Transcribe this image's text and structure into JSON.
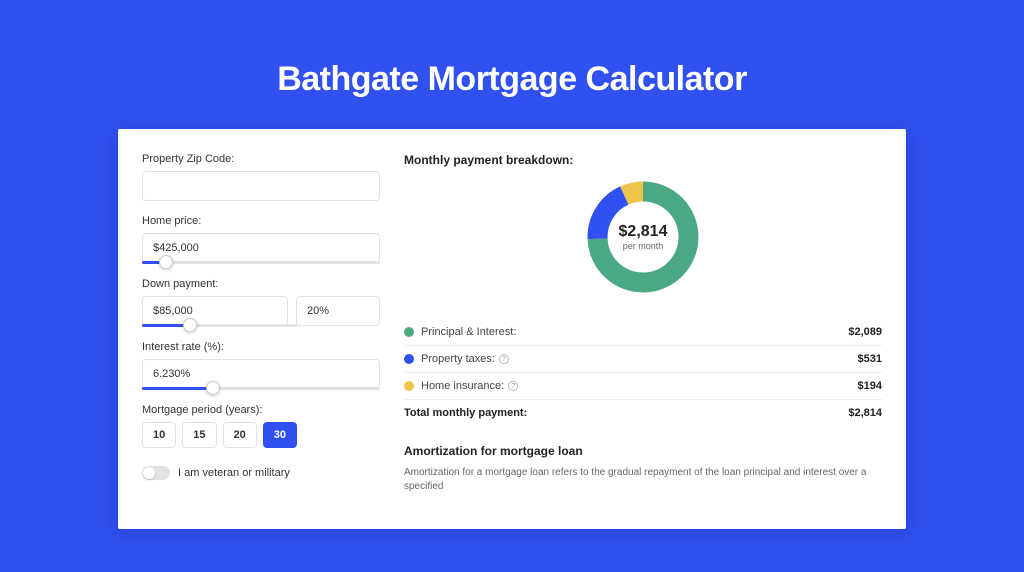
{
  "title": "Bathgate Mortgage Calculator",
  "form": {
    "zip_label": "Property Zip Code:",
    "zip_value": "",
    "home_price_label": "Home price:",
    "home_price_value": "$425,000",
    "home_price_slider_pct": 10,
    "down_payment_label": "Down payment:",
    "down_payment_value": "$85,000",
    "down_payment_percent": "20%",
    "down_payment_slider_pct": 20,
    "interest_label": "Interest rate (%):",
    "interest_value": "6.230%",
    "interest_slider_pct": 30,
    "period_label": "Mortgage period (years):",
    "periods": [
      "10",
      "15",
      "20",
      "30"
    ],
    "period_selected": "30",
    "veteran_label": "I am veteran or military"
  },
  "breakdown": {
    "title": "Monthly payment breakdown:",
    "center_amount": "$2,814",
    "center_sub": "per month",
    "items": [
      {
        "label": "Principal & Interest:",
        "value": "$2,089",
        "color": "green",
        "help": false
      },
      {
        "label": "Property taxes:",
        "value": "$531",
        "color": "blue",
        "help": true
      },
      {
        "label": "Home insurance:",
        "value": "$194",
        "color": "yellow",
        "help": true
      }
    ],
    "total_label": "Total monthly payment:",
    "total_value": "$2,814"
  },
  "chart_data": {
    "type": "pie",
    "title": "Monthly payment breakdown",
    "series": [
      {
        "name": "Principal & Interest",
        "value": 2089,
        "color": "#4aa883"
      },
      {
        "name": "Property taxes",
        "value": 531,
        "color": "#3050f0"
      },
      {
        "name": "Home insurance",
        "value": 194,
        "color": "#f0c44a"
      }
    ],
    "total": 2814
  },
  "amortization": {
    "title": "Amortization for mortgage loan",
    "text": "Amortization for a mortgage loan refers to the gradual repayment of the loan principal and interest over a specified"
  }
}
